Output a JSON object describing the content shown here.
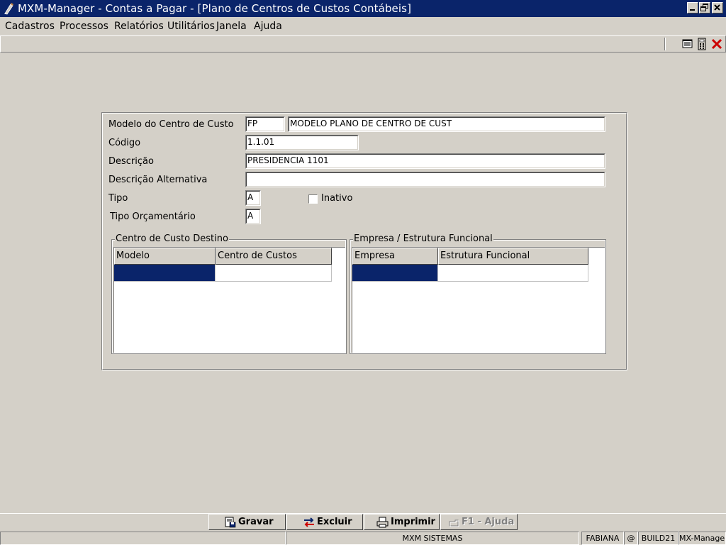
{
  "window": {
    "title": "MXM-Manager  -  Contas a Pagar - [Plano de Centros de Custos Contábeis]",
    "app_icon": "pen-icon",
    "controls": [
      "minimize-icon",
      "restore-icon",
      "close-icon"
    ]
  },
  "menu": {
    "items": [
      {
        "label": "Cadastros"
      },
      {
        "label": "Processos"
      },
      {
        "label": "Relatórios"
      },
      {
        "label": "Utilitários"
      },
      {
        "label": "Janela"
      },
      {
        "label": "Ajuda"
      }
    ]
  },
  "toolbar": {
    "icons": [
      "window-tile-icon",
      "calculator-icon",
      "close-x-icon"
    ],
    "close_color": "#cc0000"
  },
  "form": {
    "modelo_label": "Modelo do Centro de Custo",
    "modelo_code": "FP",
    "modelo_name": "MODELO PLANO DE CENTRO DE CUST",
    "codigo_label": "Código",
    "codigo_value": "1.1.01",
    "descricao_label": "Descrição",
    "descricao_value": "PRESIDENCIA 1101",
    "descricao_alt_label": "Descrição Alternativa",
    "descricao_alt_value": "",
    "tipo_label": "Tipo",
    "tipo_value": "A",
    "inativo_label": "Inativo",
    "inativo_checked": false,
    "tipo_orc_label": "Tipo Orçamentário",
    "tipo_orc_value": "A"
  },
  "centro_destino": {
    "title": "Centro de Custo Destino",
    "columns": [
      "Modelo",
      "Centro de Custos"
    ]
  },
  "empresa": {
    "title": "Empresa / Estrutura Funcional",
    "columns": [
      "Empresa",
      "Estrutura Funcional"
    ]
  },
  "buttons": {
    "gravar": "Gravar",
    "excluir": "Excluir",
    "imprimir": "Imprimir",
    "ajuda": "F1 - Ajuda",
    "ajuda_enabled": false
  },
  "status": {
    "company": "MXM SISTEMAS",
    "user": "FABIANA",
    "at": "@",
    "build": "BUILD21",
    "app": "MX-Manager"
  },
  "colors": {
    "titlebar": "#0a246a",
    "selection": "#0a246a",
    "background": "#d4d0c8"
  }
}
